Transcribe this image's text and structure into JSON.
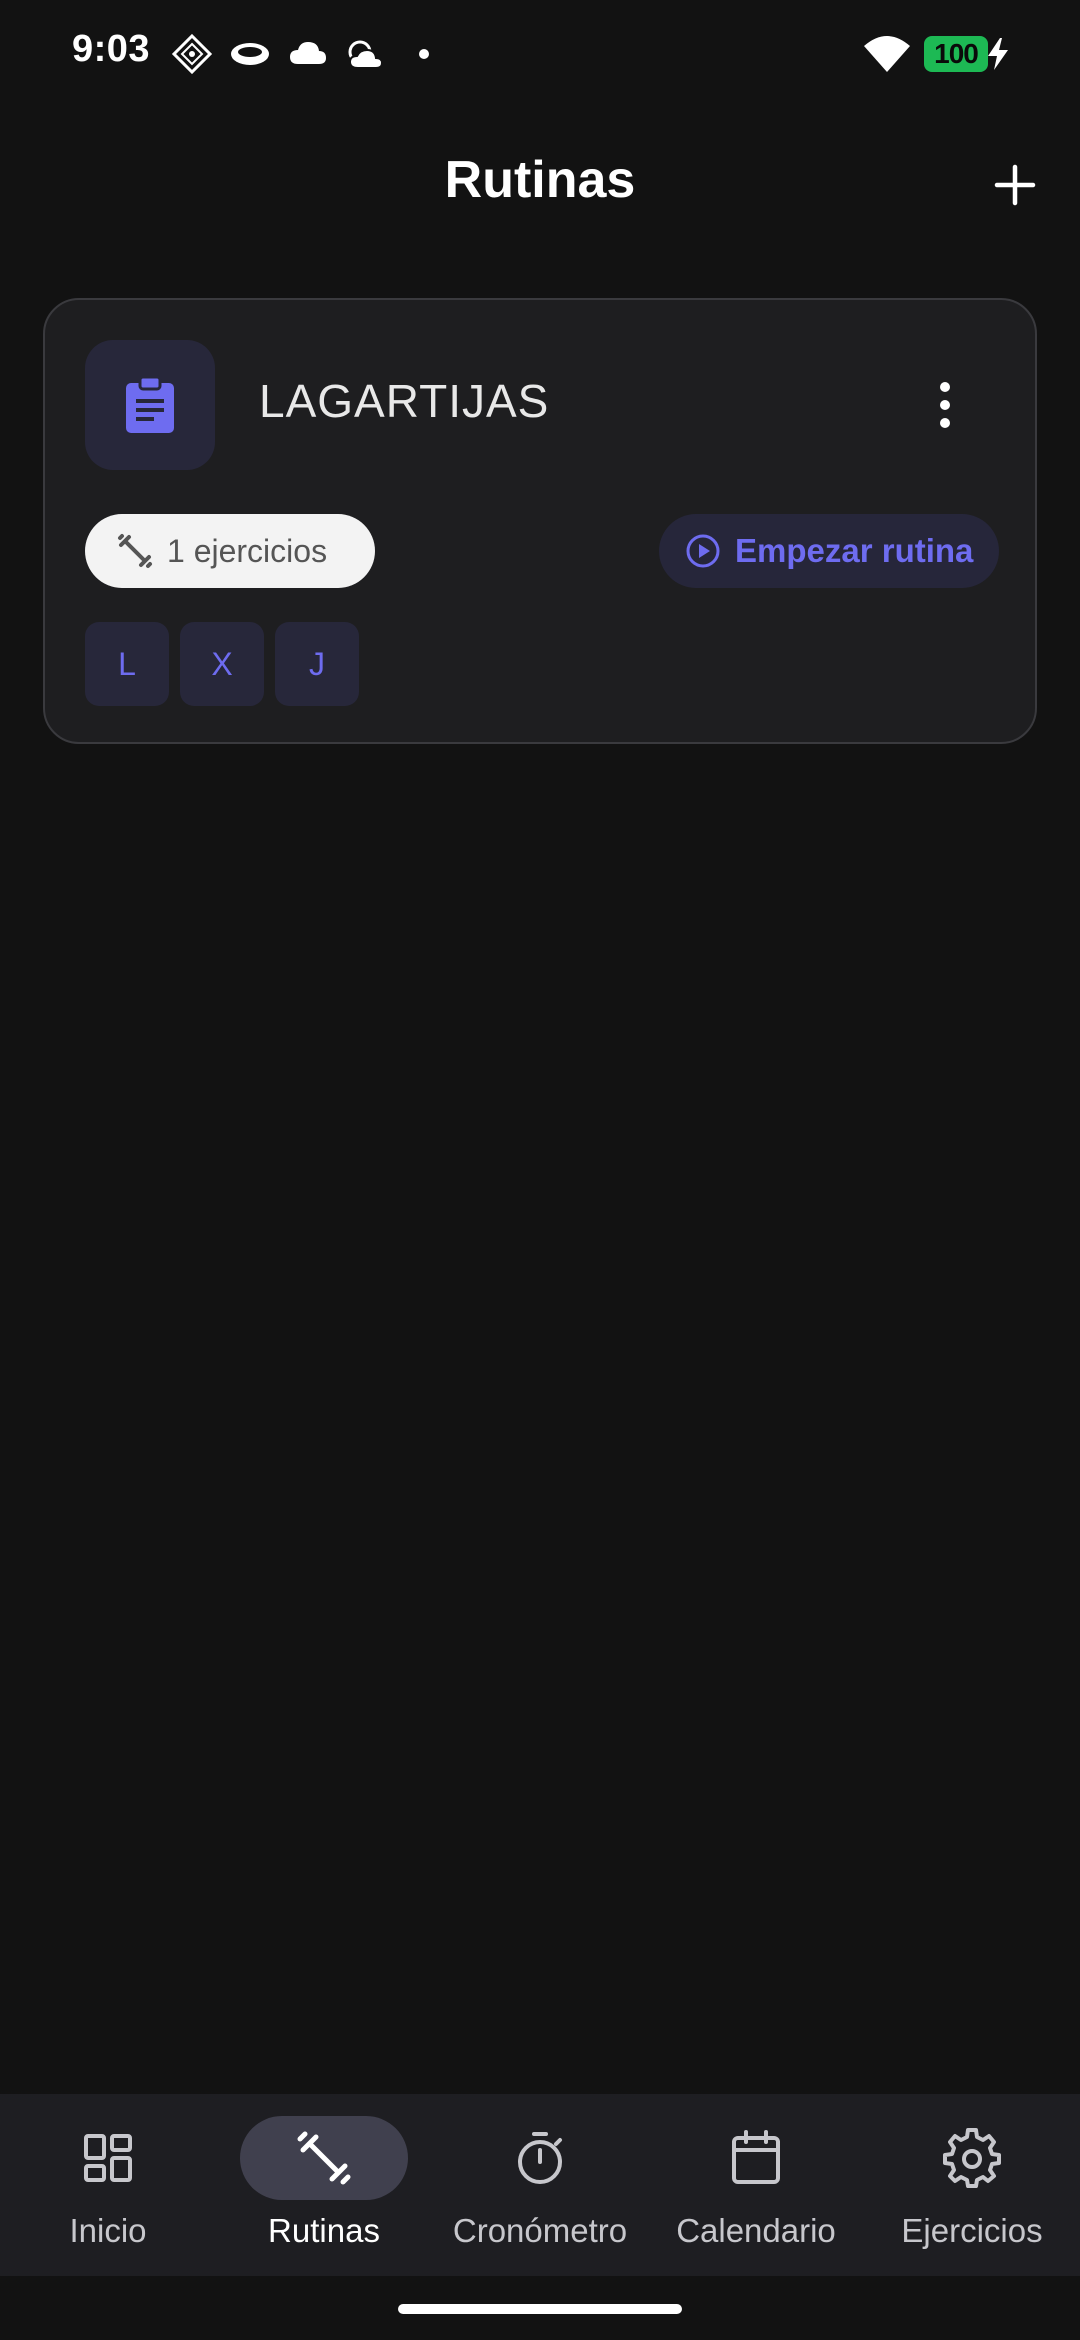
{
  "status_bar": {
    "time": "9:03",
    "battery": "100",
    "icons": [
      "navigation-diamond-icon",
      "headset-icon",
      "cloud-icon",
      "weather-icon",
      "notification-dot-icon",
      "wifi-icon",
      "battery-icon",
      "charging-bolt-icon"
    ]
  },
  "app_bar": {
    "title": "Rutinas",
    "add_icon": "plus-icon"
  },
  "routine_card": {
    "icon": "clipboard-icon",
    "title": "LAGARTIJAS",
    "menu_icon": "more-vertical-icon",
    "exercise_count_label": "1 ejercicios",
    "exercise_icon": "dumbbell-icon",
    "start_label": "Empezar rutina",
    "start_icon": "play-circle-icon",
    "days": [
      "L",
      "X",
      "J"
    ]
  },
  "bottom_nav": {
    "active": "Rutinas",
    "items": [
      {
        "label": "Inicio",
        "icon": "dashboard-icon"
      },
      {
        "label": "Rutinas",
        "icon": "dumbbell-icon"
      },
      {
        "label": "Cronómetro",
        "icon": "stopwatch-icon"
      },
      {
        "label": "Calendario",
        "icon": "calendar-icon"
      },
      {
        "label": "Ejercicios",
        "icon": "gear-icon"
      }
    ]
  },
  "colors": {
    "background": "#121212",
    "card": "#1e1e20",
    "accent": "#6e6cf0",
    "battery": "#1db954",
    "nav_background": "#1e1e22"
  }
}
